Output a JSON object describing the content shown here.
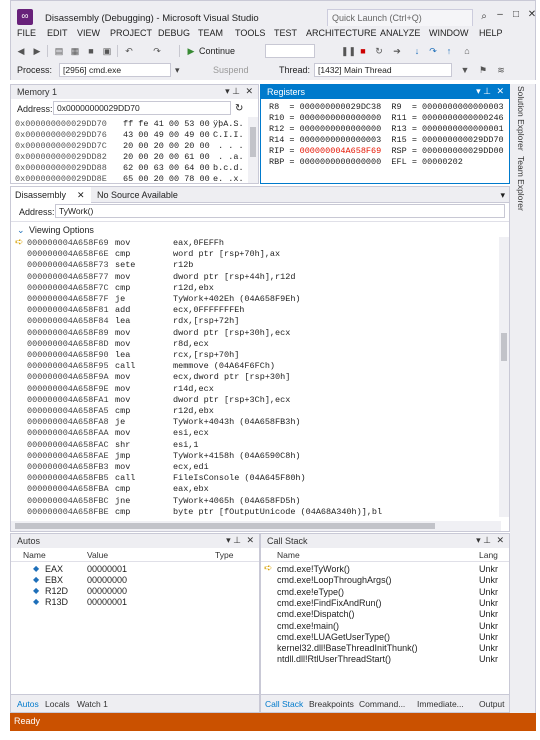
{
  "window": {
    "title": "Disassembly (Debugging) - Microsoft Visual Studio",
    "quick_launch_placeholder": "Quick Launch (Ctrl+Q)"
  },
  "menu": [
    "FILE",
    "EDIT",
    "VIEW",
    "PROJECT",
    "DEBUG",
    "TEAM",
    "TOOLS",
    "TEST",
    "ARCHITECTURE",
    "ANALYZE",
    "WINDOW",
    "HELP"
  ],
  "toolbar": {
    "continue_label": "Continue",
    "process_label": "Process:",
    "process_value": "[2956] cmd.exe",
    "suspend_label": "Suspend",
    "thread_label": "Thread:",
    "thread_value": "[1432] Main Thread"
  },
  "memory": {
    "title": "Memory 1",
    "address_label": "Address:",
    "address_value": "0x00000000029DD70",
    "rows": [
      {
        "addr": "0x000000000029DD70",
        "hex": "ff fe 41 00 53 00",
        "ascii": "ÿþA.S."
      },
      {
        "addr": "0x000000000029DD76",
        "hex": "43 00 49 00 49 00",
        "ascii": "C.I.I."
      },
      {
        "addr": "0x000000000029DD7C",
        "hex": "20 00 20 00 20 00",
        "ascii": " . . ."
      },
      {
        "addr": "0x000000000029DD82",
        "hex": "20 00 20 00 61 00",
        "ascii": " . .a."
      },
      {
        "addr": "0x000000000029DD88",
        "hex": "62 00 63 00 64 00",
        "ascii": "b.c.d."
      },
      {
        "addr": "0x000000000029DD8E",
        "hex": "65 00 20 00 78 00",
        "ascii": "e. .x."
      }
    ]
  },
  "registers": {
    "title": "Registers",
    "rows": [
      {
        "l": "R8  = 000000000029DC38",
        "r": "R9  = 0000000000000003"
      },
      {
        "l": "R10 = 0000000000000000",
        "r": "R11 = 0000000000000246"
      },
      {
        "l": "R12 = 0000000000000000",
        "r": "R13 = 0000000000000001"
      },
      {
        "l": "R14 = 0000000000000003",
        "r": "R15 = 000000000029DD70"
      },
      {
        "l": "RIP = ",
        "rip": "000000004A658F69",
        "r": "RSP = 000000000029DD00"
      },
      {
        "l": "RBP = 0000000000000000",
        "r": "EFL = 00000202"
      }
    ]
  },
  "disassembly": {
    "tab_label": "Disassembly",
    "tab2_label": "No Source Available",
    "address_label": "Address:",
    "address_value": "TyWork()",
    "viewing_options": "Viewing Options",
    "lines": [
      {
        "addr": "000000004A658F69",
        "op": "mov",
        "args": "eax,0FEFFh"
      },
      {
        "addr": "000000004A658F6E",
        "op": "cmp",
        "args": "word ptr [rsp+70h],ax"
      },
      {
        "addr": "000000004A658F73",
        "op": "sete",
        "args": "r12b"
      },
      {
        "addr": "000000004A658F77",
        "op": "mov",
        "args": "dword ptr [rsp+44h],r12d"
      },
      {
        "addr": "000000004A658F7C",
        "op": "cmp",
        "args": "r12d,ebx"
      },
      {
        "addr": "000000004A658F7F",
        "op": "je",
        "args": "TyWork+402Eh (04A658F9Eh)"
      },
      {
        "addr": "000000004A658F81",
        "op": "add",
        "args": "ecx,0FFFFFFFEh"
      },
      {
        "addr": "000000004A658F84",
        "op": "lea",
        "args": "rdx,[rsp+72h]"
      },
      {
        "addr": "000000004A658F89",
        "op": "mov",
        "args": "dword ptr [rsp+30h],ecx"
      },
      {
        "addr": "000000004A658F8D",
        "op": "mov",
        "args": "r8d,ecx"
      },
      {
        "addr": "000000004A658F90",
        "op": "lea",
        "args": "rcx,[rsp+70h]"
      },
      {
        "addr": "000000004A658F95",
        "op": "call",
        "args": "memmove (04A64F6FCh)"
      },
      {
        "addr": "000000004A658F9A",
        "op": "mov",
        "args": "ecx,dword ptr [rsp+30h]"
      },
      {
        "addr": "000000004A658F9E",
        "op": "mov",
        "args": "r14d,ecx"
      },
      {
        "addr": "000000004A658FA1",
        "op": "mov",
        "args": "dword ptr [rsp+3Ch],ecx"
      },
      {
        "addr": "000000004A658FA5",
        "op": "cmp",
        "args": "r12d,ebx"
      },
      {
        "addr": "000000004A658FA8",
        "op": "je",
        "args": "TyWork+4043h (04A658FB3h)"
      },
      {
        "addr": "000000004A658FAA",
        "op": "mov",
        "args": "esi,ecx"
      },
      {
        "addr": "000000004A658FAC",
        "op": "shr",
        "args": "esi,1"
      },
      {
        "addr": "000000004A658FAE",
        "op": "jmp",
        "args": "TyWork+4158h (04A6590C8h)"
      },
      {
        "addr": "000000004A658FB3",
        "op": "mov",
        "args": "ecx,edi"
      },
      {
        "addr": "000000004A658FB5",
        "op": "call",
        "args": "FileIsConsole (04A645F80h)"
      },
      {
        "addr": "000000004A658FBA",
        "op": "cmp",
        "args": "eax,ebx"
      },
      {
        "addr": "000000004A658FBC",
        "op": "jne",
        "args": "TyWork+4065h (04A658FD5h)"
      },
      {
        "addr": "000000004A658FBE",
        "op": "cmp",
        "args": "byte ptr [fOutputUnicode (04A68A340h)],bl"
      }
    ]
  },
  "autos": {
    "title": "Autos",
    "col_name": "Name",
    "col_value": "Value",
    "col_type": "Type",
    "rows": [
      {
        "name": "EAX",
        "value": "00000001"
      },
      {
        "name": "EBX",
        "value": "00000000"
      },
      {
        "name": "R12D",
        "value": "00000000"
      },
      {
        "name": "R13D",
        "value": "00000001"
      }
    ],
    "tabs": [
      "Autos",
      "Locals",
      "Watch 1"
    ]
  },
  "callstack": {
    "title": "Call Stack",
    "col_name": "Name",
    "col_lang": "Lang",
    "rows": [
      {
        "name": "cmd.exe!TyWork()",
        "lang": "Unkr"
      },
      {
        "name": "cmd.exe!LoopThroughArgs()",
        "lang": "Unkr"
      },
      {
        "name": "cmd.exe!eType()",
        "lang": "Unkr"
      },
      {
        "name": "cmd.exe!FindFixAndRun()",
        "lang": "Unkr"
      },
      {
        "name": "cmd.exe!Dispatch()",
        "lang": "Unkr"
      },
      {
        "name": "cmd.exe!main()",
        "lang": "Unkr"
      },
      {
        "name": "cmd.exe!LUAGetUserType()",
        "lang": "Unkr"
      },
      {
        "name": "kernel32.dll!BaseThreadInitThunk()",
        "lang": "Unkr"
      },
      {
        "name": "ntdll.dll!RtlUserThreadStart()",
        "lang": "Unkr"
      }
    ],
    "tabs": [
      "Call Stack",
      "Breakpoints",
      "Command...",
      "Immediate...",
      "Output"
    ]
  },
  "sidebar_tabs": [
    "Solution Explorer",
    "Team Explorer"
  ],
  "status": "Ready",
  "colors": {
    "accent": "#007acc",
    "status": "#ca5100",
    "rip": "#e51400"
  }
}
